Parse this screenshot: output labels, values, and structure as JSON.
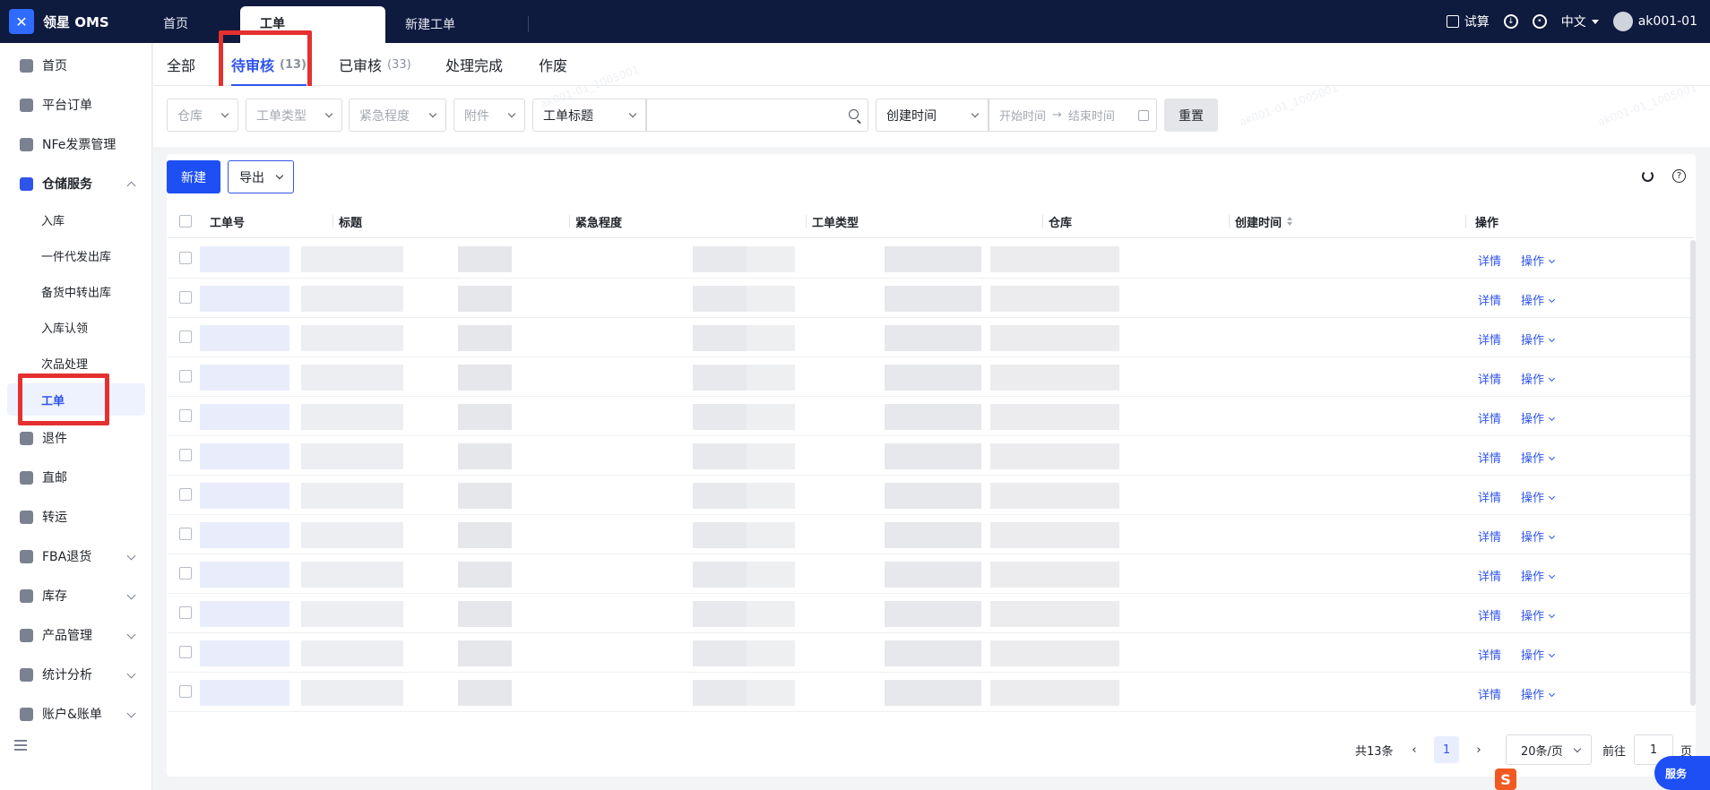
{
  "app": {
    "logo_text": "领星 OMS"
  },
  "top_tabs": [
    {
      "label": "首页"
    },
    {
      "label": "工单"
    },
    {
      "label": "新建工单"
    }
  ],
  "top_right": {
    "trial": "试算",
    "language": "中文",
    "user": "ak001-01"
  },
  "sidebar": {
    "items": [
      {
        "label": "首页"
      },
      {
        "label": "平台订单"
      },
      {
        "label": "NFe发票管理"
      },
      {
        "label": "仓储服务"
      },
      {
        "label": "入库"
      },
      {
        "label": "一件代发出库"
      },
      {
        "label": "备货中转出库"
      },
      {
        "label": "入库认领"
      },
      {
        "label": "次品处理"
      },
      {
        "label": "工单"
      },
      {
        "label": "退件"
      },
      {
        "label": "直邮"
      },
      {
        "label": "转运"
      },
      {
        "label": "FBA退货"
      },
      {
        "label": "库存"
      },
      {
        "label": "产品管理"
      },
      {
        "label": "统计分析"
      },
      {
        "label": "账户&账单"
      }
    ]
  },
  "status_tabs": [
    {
      "label": "全部",
      "count": ""
    },
    {
      "label": "待审核",
      "count": "(13)"
    },
    {
      "label": "已审核",
      "count": "(33)"
    },
    {
      "label": "处理完成",
      "count": ""
    },
    {
      "label": "作废",
      "count": ""
    }
  ],
  "filters": {
    "warehouse": "仓库",
    "type": "工单类型",
    "urgency": "紧急程度",
    "attachment": "附件",
    "field": "工单标题",
    "search_value": "",
    "date_field": "创建时间",
    "start_placeholder": "开始时间",
    "arrow": "→",
    "end_placeholder": "结束时间",
    "reset": "重置"
  },
  "toolbar": {
    "new": "新建",
    "export": "导出",
    "help": "?"
  },
  "table": {
    "columns": [
      "工单号",
      "标题",
      "紧急程度",
      "工单类型",
      "仓库",
      "创建时间",
      "操作"
    ],
    "row_actions": {
      "detail": "详情",
      "op": "操作"
    },
    "row_count": 12
  },
  "pagination": {
    "total": "共13条",
    "current": "1",
    "page_size": "20条/页",
    "goto_label": "前往",
    "goto_value": "1",
    "page_suffix": "页"
  },
  "service": {
    "label": "服务"
  },
  "watermark": "ak001-01_1005001"
}
